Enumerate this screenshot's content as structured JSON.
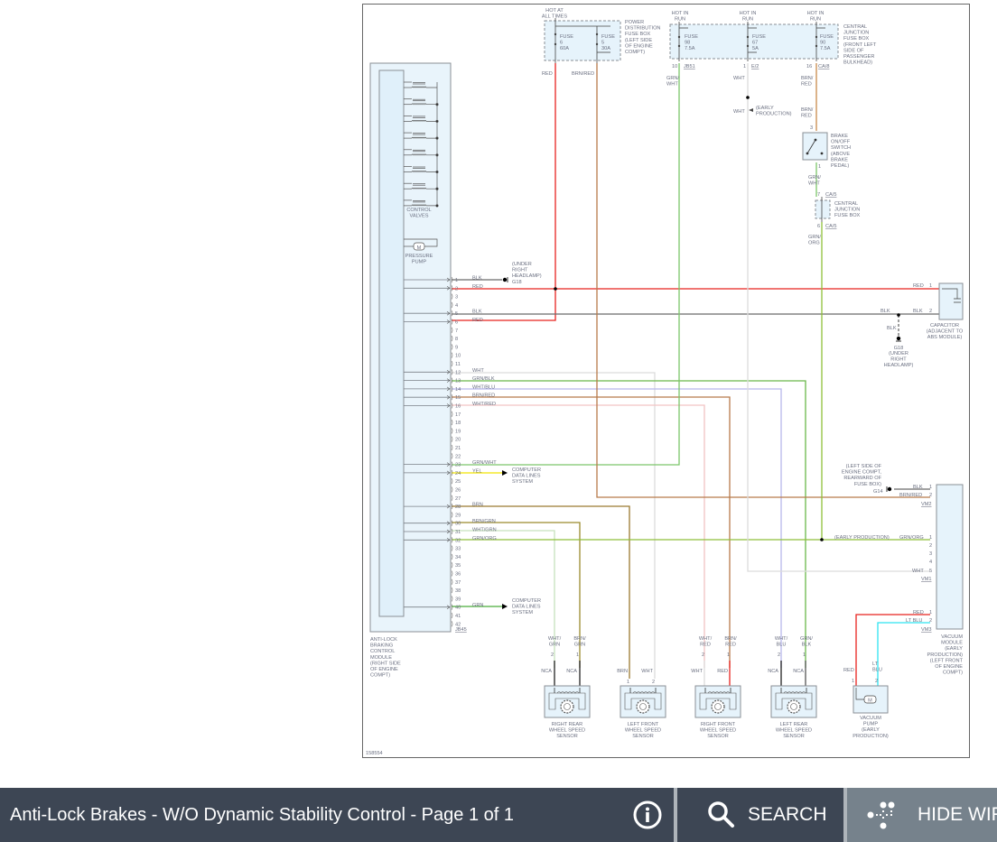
{
  "footer": {
    "title": "Anti-Lock Brakes - W/O Dynamic Stability Control - Page 1 of 1",
    "info_icon": "info-icon",
    "search_label": "SEARCH",
    "hide_wiring_label": "HIDE WIRING"
  },
  "diagram": {
    "figure_id": "158554",
    "pdb": {
      "hot": [
        "HOT AT",
        "ALL TIMES"
      ],
      "name": [
        "POWER",
        "DISTRIBUTION",
        "FUSE BOX",
        "(LEFT SIDE",
        "OF ENGINE",
        "COMPT)"
      ],
      "fuse_6": [
        "FUSE",
        "6",
        "60A"
      ],
      "fuse_5": [
        "FUSE",
        "5",
        "30A"
      ],
      "wire_red": "RED",
      "wire_brnred": "BRN/RED"
    },
    "cjb": {
      "hot_98": [
        "HOT IN",
        "RUN"
      ],
      "hot_67": [
        "HOT IN",
        "RUN"
      ],
      "hot_90": [
        "HOT IN",
        "RUN"
      ],
      "fuse_98": [
        "FUSE",
        "98",
        "7.5A"
      ],
      "fuse_67": [
        "FUSE",
        "67",
        "5A"
      ],
      "fuse_90": [
        "FUSE",
        "90",
        "7.5A"
      ],
      "name": [
        "CENTRAL",
        "JUNCTION",
        "FUSE BOX",
        "(FRONT LEFT",
        "SIDE OF",
        "PASSENGER",
        "BULKHEAD)"
      ],
      "pin_98": "10",
      "conn_98": "JB51",
      "pin_67": "1",
      "conn_67": "E/2",
      "pin_90": "16",
      "conn_90": "CA/8",
      "wire_98": [
        "GRN/",
        "WHT"
      ],
      "wire_67": "WHT",
      "wire_90": [
        "BRN/",
        "RED"
      ],
      "wire_67b": "WHT",
      "early_production": [
        "(EARLY",
        "PRODUCTION)"
      ],
      "wire_90b": [
        "BRN/",
        "RED"
      ]
    },
    "brake_switch": {
      "pin_in": "3",
      "pin_out": "1",
      "name": [
        "BRAKE",
        "ON/OFF",
        "SWITCH",
        "(ABOVE",
        "BRAKE",
        "PEDAL)"
      ],
      "wire_out": [
        "GRN/",
        "WHT"
      ]
    },
    "cjb_small": {
      "pin_in": "7",
      "conn_in": "CA/5",
      "pin_out": "6",
      "conn_out": "CA/5",
      "name": [
        "CENTRAL",
        "JUNCTION",
        "FUSE BOX"
      ],
      "wire_out": [
        "GRN/",
        "ORG"
      ]
    },
    "abs_module": {
      "control_valves": [
        "CONTROL",
        "VALVES"
      ],
      "pressure_pump": [
        "PRESSURE",
        "PUMP"
      ],
      "motor": "M",
      "connector": "JB45",
      "name": [
        "ANTI-LOCK",
        "BRAKING",
        "CONTROL",
        "MODULE",
        "(RIGHT SIDE",
        "OF ENGINE",
        "COMPT)"
      ],
      "pins": [
        {
          "n": "1",
          "label": "BLK"
        },
        {
          "n": "2",
          "label": "RED"
        },
        {
          "n": "3",
          "label": ""
        },
        {
          "n": "4",
          "label": ""
        },
        {
          "n": "5",
          "label": "BLK"
        },
        {
          "n": "6",
          "label": "RED"
        },
        {
          "n": "7",
          "label": ""
        },
        {
          "n": "8",
          "label": ""
        },
        {
          "n": "9",
          "label": ""
        },
        {
          "n": "10",
          "label": ""
        },
        {
          "n": "11",
          "label": ""
        },
        {
          "n": "12",
          "label": "WHT"
        },
        {
          "n": "13",
          "label": "GRN/BLK"
        },
        {
          "n": "14",
          "label": "WHT/BLU"
        },
        {
          "n": "15",
          "label": "BRN/RED"
        },
        {
          "n": "16",
          "label": "WHT/RED"
        },
        {
          "n": "17",
          "label": ""
        },
        {
          "n": "18",
          "label": ""
        },
        {
          "n": "19",
          "label": ""
        },
        {
          "n": "20",
          "label": ""
        },
        {
          "n": "21",
          "label": ""
        },
        {
          "n": "22",
          "label": ""
        },
        {
          "n": "23",
          "label": "GRN/WHT"
        },
        {
          "n": "24",
          "label": "YEL"
        },
        {
          "n": "25",
          "label": ""
        },
        {
          "n": "26",
          "label": ""
        },
        {
          "n": "27",
          "label": ""
        },
        {
          "n": "28",
          "label": "BRN"
        },
        {
          "n": "29",
          "label": ""
        },
        {
          "n": "30",
          "label": "BRN/GRN"
        },
        {
          "n": "31",
          "label": "WHT/GRN"
        },
        {
          "n": "32",
          "label": "GRN/ORG"
        },
        {
          "n": "33",
          "label": ""
        },
        {
          "n": "34",
          "label": ""
        },
        {
          "n": "35",
          "label": ""
        },
        {
          "n": "36",
          "label": ""
        },
        {
          "n": "37",
          "label": ""
        },
        {
          "n": "38",
          "label": ""
        },
        {
          "n": "39",
          "label": ""
        },
        {
          "n": "40",
          "label": "GRN"
        },
        {
          "n": "41",
          "label": ""
        },
        {
          "n": "42",
          "label": ""
        }
      ]
    },
    "g18_top": {
      "location": [
        "(UNDER",
        "RIGHT",
        "HEADLAMP)"
      ],
      "id": "G18"
    },
    "data_lines_1": [
      "COMPUTER",
      "DATA LINES",
      "SYSTEM"
    ],
    "data_lines_2": [
      "COMPUTER",
      "DATA LINES",
      "SYSTEM"
    ],
    "capacitor": {
      "wire_1": "RED",
      "pin_1": "1",
      "wire_2a": "BLK",
      "wire_2b": "BLK",
      "pin_2": "2",
      "wire_gnd": "BLK",
      "name": [
        "CAPACITOR",
        "(ADJACENT TO",
        "ABS MODULE)"
      ],
      "ground_id": "G18",
      "ground_location": [
        "(UNDER",
        "RIGHT",
        "HEADLAMP)"
      ]
    },
    "vacuum_module": {
      "g14_location": [
        "(LEFT SIDE OF",
        "ENGINE COMPT,",
        "REARWARD OF",
        "FUSE BOX)"
      ],
      "g14_id": "G14",
      "vm2": {
        "w1": "BLK",
        "p1": "1",
        "w2": "BRN/RED",
        "p2": "2",
        "conn": "VM2"
      },
      "vm1": {
        "early": "(EARLY PRODUCTION)",
        "w1": "GRN/ORG",
        "p1": "1",
        "p2": "2",
        "p3": "3",
        "p4": "4",
        "w5": "WHT",
        "p5": "5",
        "conn": "VM1"
      },
      "vm3": {
        "w1": "RED",
        "p1": "1",
        "w2": "LT BLU",
        "p2": "2",
        "conn": "VM3"
      },
      "name": [
        "VACUUM",
        "MODULE",
        "(EARLY",
        "PRODUCTION)",
        "(LEFT FRONT",
        "OF ENGINE",
        "COMPT)"
      ]
    },
    "vacuum_pump": {
      "wire_1": "RED",
      "wire_2": [
        "LT",
        "BLU"
      ],
      "pin_1": "1",
      "pin_2": "2",
      "motor": "M",
      "name": [
        "VACUUM",
        "PUMP",
        "(EARLY",
        "PRODUCTION)"
      ]
    },
    "sensors": [
      {
        "name": [
          "RIGHT REAR",
          "WHEEL SPEED",
          "SENSOR"
        ],
        "wa": [
          "WHT/",
          "GRN"
        ],
        "wb": [
          "BRN/",
          "GRN"
        ],
        "pa": "2",
        "pb": "1",
        "la": "NCA",
        "lb": "NCA"
      },
      {
        "name": [
          "LEFT FRONT",
          "WHEEL SPEED",
          "SENSOR"
        ],
        "la": "BRN",
        "lb": "WHT",
        "pa": "1",
        "pb": "2"
      },
      {
        "name": [
          "RIGHT FRONT",
          "WHEEL SPEED",
          "SENSOR"
        ],
        "wa": [
          "WHT/",
          "RED"
        ],
        "wb": [
          "BRN/",
          "RED"
        ],
        "pa": "2",
        "pb": "1",
        "la": "WHT",
        "lb": "RED"
      },
      {
        "name": [
          "LEFT REAR",
          "WHEEL SPEED",
          "SENSOR"
        ],
        "wa": [
          "WHT/",
          "BLU"
        ],
        "wb": [
          "GRN/",
          "BLK"
        ],
        "pa": "2",
        "pb": "1",
        "la": "NCA",
        "lb": "NCA"
      }
    ],
    "wire_colors": {
      "red": "#e8231f",
      "blk": "#6b6b6b",
      "wht": "#dcdcdc",
      "grn_blk": "#6bb84a",
      "wht_blu": "#b8b8ec",
      "brn_red": "#b87a4a",
      "wht_red": "#f2c4c4",
      "grn_wht": "#7cc56a",
      "yel": "#f2e400",
      "brn": "#9a7a30",
      "brn_grn": "#9a8a2c",
      "wht_grn": "#c6e2bd",
      "grn_org": "#8fbf3a",
      "grn": "#4aae3a",
      "lt_blu": "#2ee3f0"
    }
  }
}
